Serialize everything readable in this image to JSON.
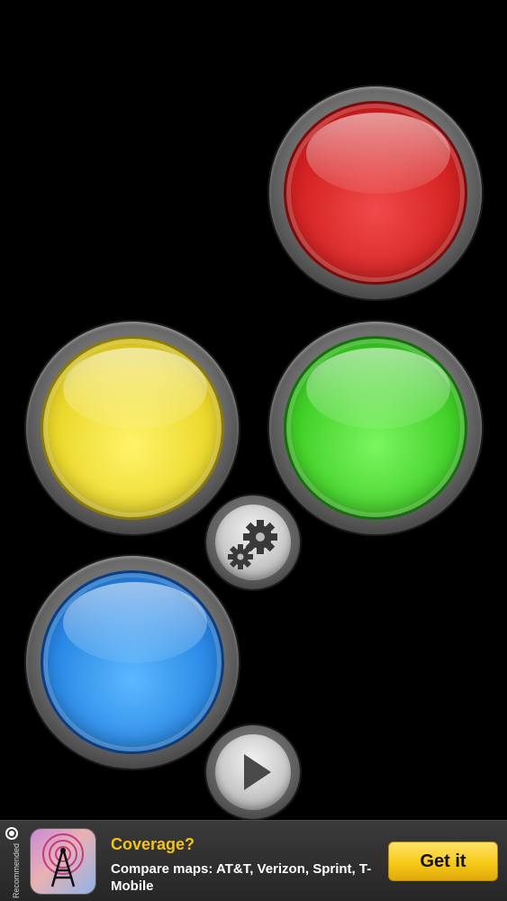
{
  "screen": {
    "background": "#000000"
  },
  "game_buttons": [
    {
      "color_name": "red",
      "color": "#d62424"
    },
    {
      "color_name": "yellow",
      "color": "#ecd92d"
    },
    {
      "color_name": "green",
      "color": "#44d22a"
    },
    {
      "color_name": "blue",
      "color": "#2b8ae6"
    }
  ],
  "controls": {
    "settings_icon": "gears-icon",
    "play_icon": "play-icon"
  },
  "ad": {
    "side_label": "Recommended",
    "side_icon": "ad-badge-icon",
    "app_icon": "radio-tower-map-icon",
    "title": "Coverage?",
    "description": "Compare maps: AT&T, Verizon, Sprint, T-Mobile",
    "cta_label": "Get it",
    "title_color": "#f4c21a",
    "cta_color": "#f7c917"
  }
}
